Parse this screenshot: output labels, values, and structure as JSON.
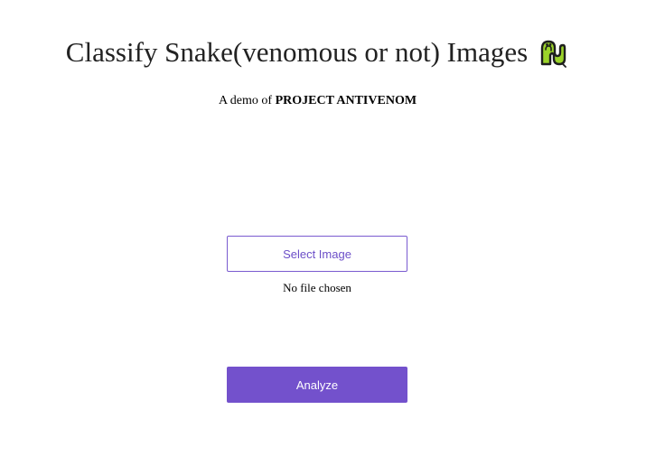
{
  "header": {
    "title": "Classify Snake(venomous or not) Images",
    "icon": "snake-icon",
    "subtitle_prefix": "A demo of ",
    "subtitle_project": "PROJECT ANTIVENOM"
  },
  "upload": {
    "select_label": "Select Image",
    "file_status": "No file chosen"
  },
  "actions": {
    "analyze_label": "Analyze"
  },
  "colors": {
    "accent": "#7351cc",
    "accent_outline": "#7a5bd0",
    "snake_green": "#9bd32a",
    "snake_outline": "#1e1e1e"
  }
}
